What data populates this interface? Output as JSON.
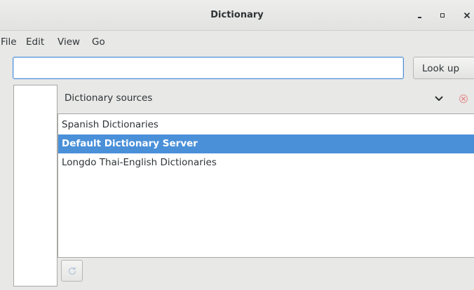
{
  "window": {
    "title": "Dictionary"
  },
  "menubar": {
    "items": [
      "File",
      "Edit",
      "View",
      "Go"
    ]
  },
  "search": {
    "value": "",
    "placeholder": ""
  },
  "toolbar": {
    "lookup_label": "Look up"
  },
  "sources": {
    "header_label": "Dictionary sources",
    "items": [
      {
        "label": "Spanish Dictionaries",
        "selected": false
      },
      {
        "label": "Default Dictionary Server",
        "selected": true
      },
      {
        "label": "Longdo Thai-English Dictionaries",
        "selected": false
      }
    ]
  },
  "icons": {
    "minimize": "minimize-icon",
    "maximize": "maximize-icon",
    "close": "close-icon",
    "expand": "chevron-down-icon",
    "remove": "remove-source-icon",
    "refresh": "refresh-icon"
  },
  "colors": {
    "selection": "#4a90d9",
    "focus_border": "#4a90d9",
    "remove_icon": "#d46a6a"
  }
}
